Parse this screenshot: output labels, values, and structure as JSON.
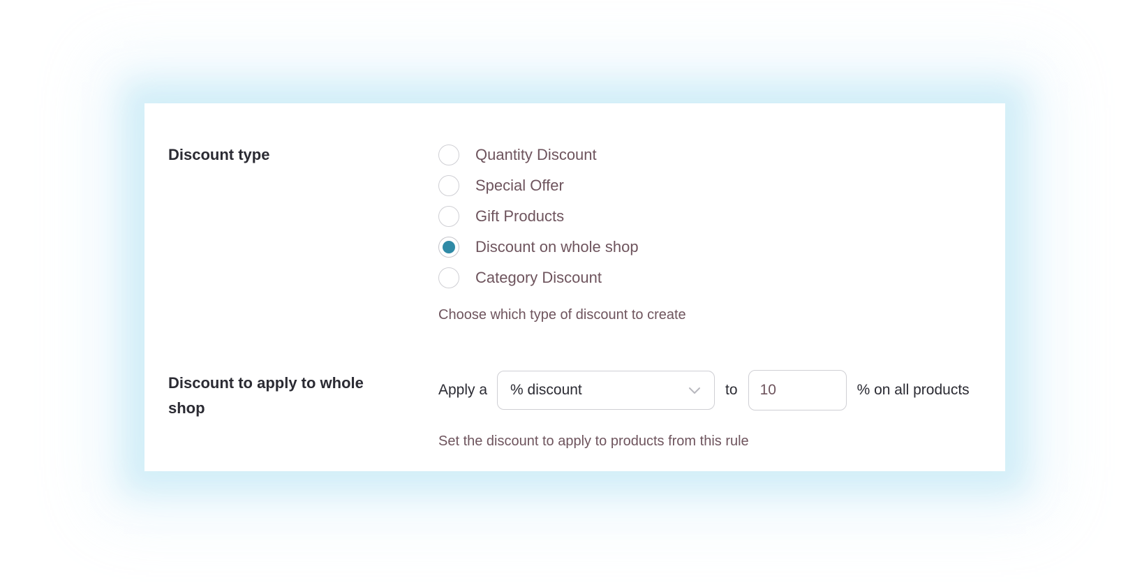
{
  "discount_type": {
    "label": "Discount type",
    "options": [
      {
        "label": "Quantity Discount",
        "checked": false
      },
      {
        "label": "Special Offer",
        "checked": false
      },
      {
        "label": "Gift Products",
        "checked": false
      },
      {
        "label": "Discount on whole shop",
        "checked": true
      },
      {
        "label": "Category Discount",
        "checked": false
      }
    ],
    "help": "Choose which type of discount to create"
  },
  "whole_shop": {
    "label": "Discount to apply to whole shop",
    "prefix": "Apply a",
    "select_value": "% discount",
    "connector": "to",
    "amount": "10",
    "suffix": "% on all products",
    "help": "Set the discount to apply to products from this rule"
  },
  "colors": {
    "accent": "#2f8aa6",
    "label_text": "#2b2b33",
    "option_text": "#6e545d",
    "border": "#cfcfd4"
  },
  "icons": {
    "select_arrow": "chevron-down-icon"
  }
}
